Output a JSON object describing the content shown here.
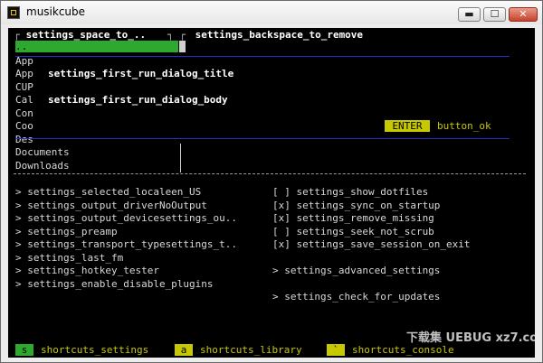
{
  "window": {
    "title": "musikcube",
    "minimize_glyph": "▬",
    "maximize_glyph": "☐",
    "close_glyph": "✕"
  },
  "dialog": {
    "corner_left": "┌",
    "tab_left": " settings_space_to_.. ",
    "sep": "┐ ┌",
    "tab_right": " settings_backspace_to_remove ",
    "title": "settings_first_run_dialog_title",
    "body": "settings_first_run_dialog_body",
    "ok_key": "ENTER",
    "ok_label": "button_ok"
  },
  "paths": [
    {
      "label": ".."
    },
    {
      "label": "App"
    },
    {
      "label": "App"
    },
    {
      "label": "CUP"
    },
    {
      "label": "Cal"
    },
    {
      "label": "Con"
    },
    {
      "label": "Coo"
    },
    {
      "label": "Des"
    },
    {
      "label": "Documents"
    },
    {
      "label": "Downloads"
    }
  ],
  "settings_left": [
    "> settings_selected_localeen_US",
    "> settings_output_driverNoOutput",
    "> settings_output_devicesettings_ou..",
    "> settings_preamp",
    "> settings_transport_typesettings_t..",
    "> settings_last_fm",
    "> settings_hotkey_tester",
    "> settings_enable_disable_plugins"
  ],
  "settings_right": [
    "[ ] settings_show_dotfiles",
    "[x] settings_sync_on_startup",
    "[x] settings_remove_missing",
    "[ ] settings_seek_not_scrub",
    "[x] settings_save_session_on_exit"
  ],
  "advanced": "> settings_advanced_settings",
  "updates": "> settings_check_for_updates",
  "shortcuts": [
    {
      "key": "s",
      "label": "shortcuts_settings"
    },
    {
      "key": "a",
      "label": "shortcuts_library"
    },
    {
      "key": "`",
      "label": "shortcuts_console"
    }
  ],
  "watermark": "下载集 UEBUG xz7.com"
}
